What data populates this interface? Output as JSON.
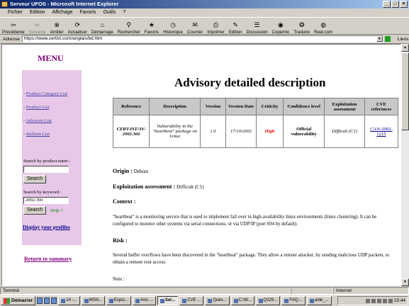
{
  "window": {
    "title": "Serveur UFOS - Microsoft Internet Explorer"
  },
  "menubar": [
    "Fichier",
    "Edition",
    "Affichage",
    "Favoris",
    "Outils",
    "?"
  ],
  "toolbar": [
    {
      "label": "Précédente",
      "icon": "back-arrow-icon",
      "glyph": "⇦",
      "disabled": false
    },
    {
      "label": "Suivante",
      "icon": "forward-arrow-icon",
      "glyph": "⇨",
      "disabled": true
    },
    {
      "label": "Arrêter",
      "icon": "stop-icon",
      "glyph": "⊗",
      "disabled": false
    },
    {
      "label": "Actualiser",
      "icon": "refresh-icon",
      "glyph": "⟳",
      "disabled": false
    },
    {
      "label": "Démarrage",
      "icon": "home-icon",
      "glyph": "⌂",
      "disabled": false
    },
    {
      "label": "Rechercher",
      "icon": "search-icon",
      "glyph": "⚲",
      "disabled": false
    },
    {
      "label": "Favoris",
      "icon": "favorites-icon",
      "glyph": "★",
      "disabled": false
    },
    {
      "label": "Historique",
      "icon": "history-icon",
      "glyph": "◷",
      "disabled": false
    },
    {
      "label": "Courrier",
      "icon": "mail-icon",
      "glyph": "✉",
      "disabled": false
    },
    {
      "label": "Imprimer",
      "icon": "print-icon",
      "glyph": "⎙",
      "disabled": false
    },
    {
      "label": "Edition",
      "icon": "edit-icon",
      "glyph": "✎",
      "disabled": false
    },
    {
      "label": "Discussion",
      "icon": "discussion-icon",
      "glyph": "☰",
      "disabled": false
    },
    {
      "label": "Copernic",
      "icon": "copernic-icon",
      "glyph": "◉",
      "disabled": false
    },
    {
      "label": "Traduire",
      "icon": "translate-icon",
      "glyph": "❂",
      "disabled": false
    },
    {
      "label": "Real.com",
      "icon": "realcom-icon",
      "glyph": "◍",
      "disabled": false
    }
  ],
  "address": {
    "label": "Adresse",
    "url": "https://www.certist.com/anglais/bd.htm",
    "links_label": "Liens"
  },
  "sidebar": {
    "menu_title": "MENU",
    "links": [
      {
        "prefix": "- ",
        "label": "Product Category List"
      },
      {
        "prefix": "- ",
        "label": "Product List"
      },
      {
        "prefix": "- ",
        "label": "Advisory List"
      },
      {
        "prefix": "- ",
        "label": "Bulletin List"
      }
    ],
    "search_name_label": "Search by product name :",
    "search_name_value": "",
    "search_button": "Search",
    "search_keyword_label": "Search by keyword :",
    "search_keyword_value": "2002.360",
    "search_button_2": "Search",
    "help": "Help ?",
    "profiles": "Display your profiles",
    "return": "Return to summary"
  },
  "main": {
    "title": "Advisory detailed description",
    "table": {
      "headers": [
        "Reference",
        "Description",
        "Version",
        "Version Date",
        "Criticity",
        "Confidence level",
        "Exploitation assessment",
        "CVE references"
      ],
      "row": {
        "reference": "CERT-IST/AV-2002.360",
        "description": "Vulnerability in the \"heartbeat\" package on Linux",
        "version": "1.0",
        "version_date": "17/10/2002",
        "criticity": "High",
        "confidence": "Official vulnerability",
        "exploitation": "Difficult (C1)",
        "cve": "CAN-2002-1215"
      }
    },
    "origin_label": "Origin :",
    "origin_value": "Debian",
    "exploitation_label": "Exploitation assessment :",
    "exploitation_value": "Difficult (C1)",
    "context_label": "Context :",
    "context_text": "\"heartbeat\" is a monitoring service that is used to implement fail over in high-availability linux environments (linux clustering). It can be configured to monitor other systems via serial connections, or via UDP/IP (port 694 by default).",
    "risk_label": "Risk :",
    "risk_text": "Several buffer overflows have been discovered in the \"heartbeat\" package. They allow a remote attacker, by sending malicious UDP packets, to obtain a remote root access.",
    "note_label": "Note :"
  },
  "statusbar": {
    "status": "Terminé",
    "zone": "Internet"
  },
  "taskbar": {
    "start": "Démarrer",
    "tasks": [
      "14 -...",
      "MSN...",
      "Explo...",
      "Avis ...",
      "Ser...",
      "CVE ...",
      "Ques...",
      "C:\\W...",
      "Q329...",
      "FAQ:...",
      "aide_..."
    ],
    "active_index": 4,
    "clock": "15:44"
  }
}
